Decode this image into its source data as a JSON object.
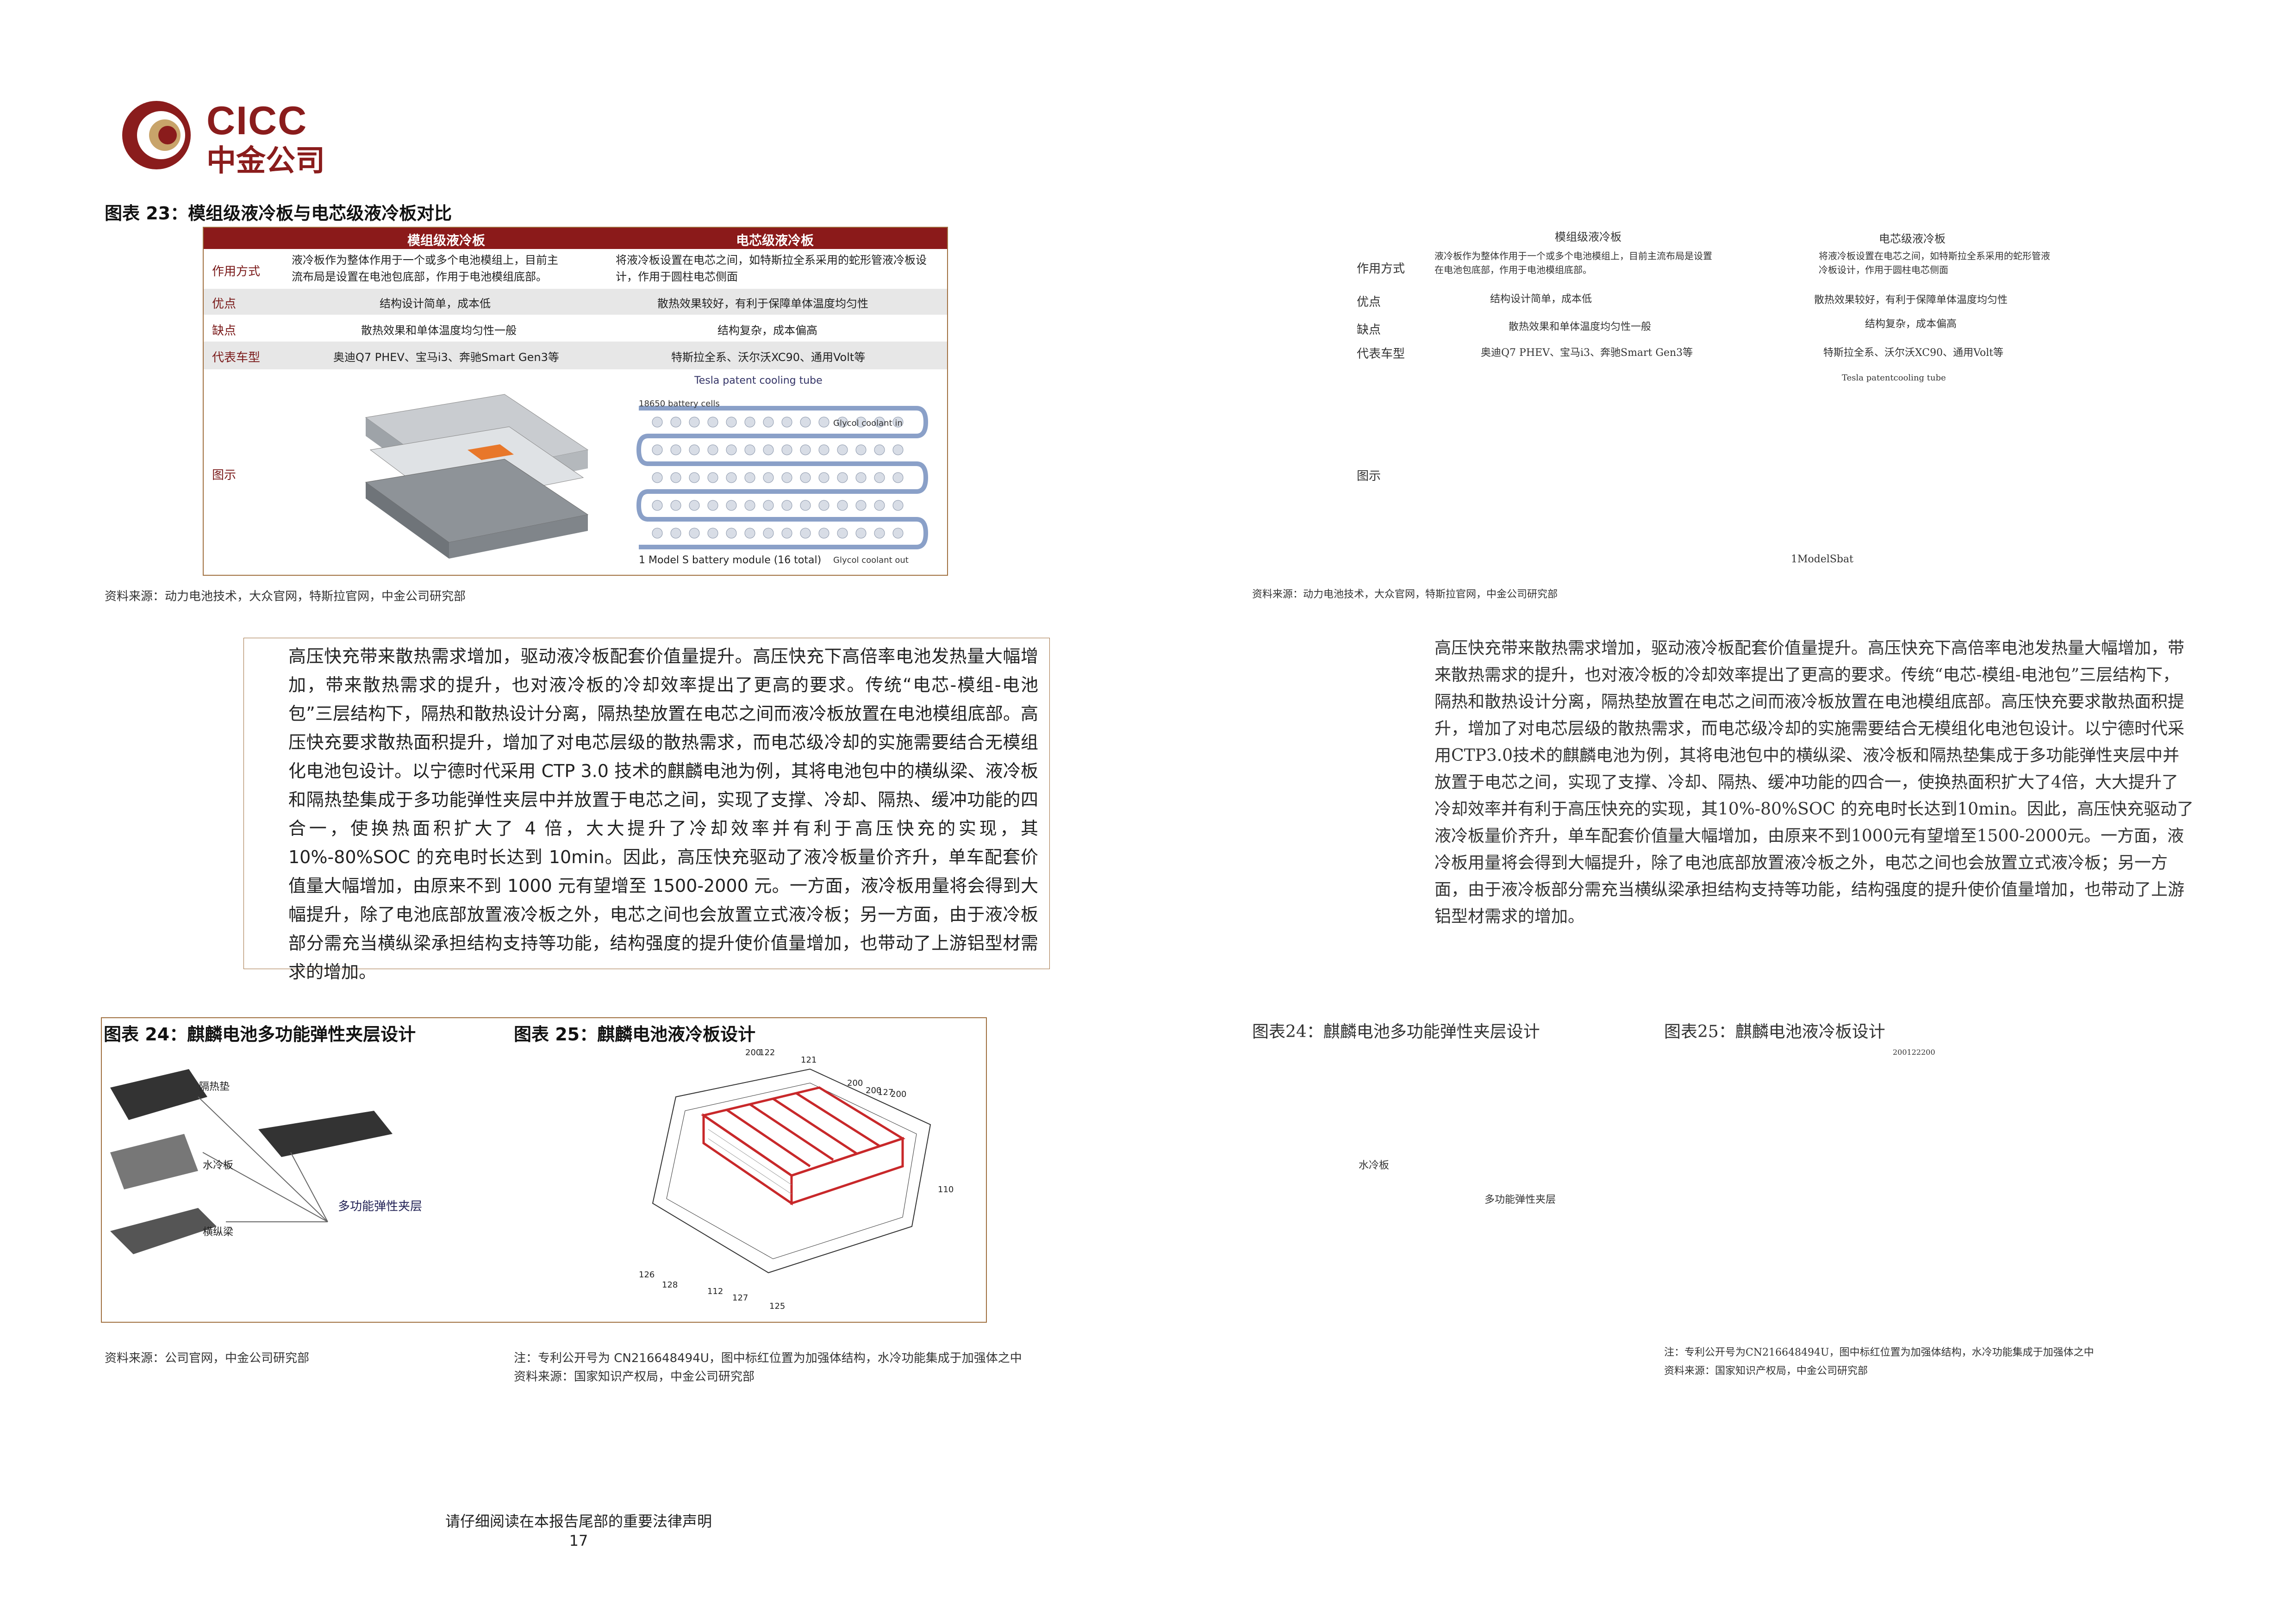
{
  "logo": {
    "brand_en": "CICC",
    "brand_cn": "中金公司"
  },
  "fig23": {
    "title": "图表 23：模组级液冷板与电芯级液冷板对比",
    "col1": "模组级液冷板",
    "col2": "电芯级液冷板",
    "rows": [
      {
        "label": "作用方式",
        "c1": "液冷板作为整体作用于一个或多个电池模组上，目前主流布局是设置在电池包底部，作用于电池模组底部。",
        "c2": "将液冷板设置在电芯之间，如特斯拉全系采用的蛇形管液冷板设计，作用于圆柱电芯侧面"
      },
      {
        "label": "优点",
        "c1": "结构设计简单，成本低",
        "c2": "散热效果较好，有利于保障单体温度均匀性"
      },
      {
        "label": "缺点",
        "c1": "散热效果和单体温度均匀性一般",
        "c2": "结构复杂，成本偏高"
      },
      {
        "label": "代表车型",
        "c1": "奥迪Q7 PHEV、宝马i3、奔驰Smart Gen3等",
        "c2": "特斯拉全系、沃尔沃XC90、通用Volt等"
      }
    ],
    "img_label": "图示",
    "c2_caption": "Tesla patent cooling tube",
    "c2_cells": "18650 battery cells",
    "c2_coolant_in": "Glycol coolant in",
    "c2_coolant_out": "Glycol coolant out",
    "c2_module": "1 Model S battery module (16 total)",
    "source": "资料来源：动力电池技术，大众官网，特斯拉官网，中金公司研究部"
  },
  "para": "高压快充带来散热需求增加，驱动液冷板配套价值量提升。高压快充下高倍率电池发热量大幅增加，带来散热需求的提升，也对液冷板的冷却效率提出了更高的要求。传统“电芯-模组-电池包”三层结构下，隔热和散热设计分离，隔热垫放置在电芯之间而液冷板放置在电池模组底部。高压快充要求散热面积提升，增加了对电芯层级的散热需求，而电芯级冷却的实施需要结合无模组化电池包设计。以宁德时代采用 CTP 3.0 技术的麒麟电池为例，其将电池包中的横纵梁、液冷板和隔热垫集成于多功能弹性夹层中并放置于电芯之间，实现了支撑、冷却、隔热、缓冲功能的四合一，使换热面积扩大了 4 倍，大大提升了冷却效率并有利于高压快充的实现，其 10%-80%SOC 的充电时长达到 10min。因此，高压快充驱动了液冷板量价齐升，单车配套价值量大幅增加，由原来不到 1000 元有望增至 1500-2000 元。一方面，液冷板用量将会得到大幅提升，除了电池底部放置液冷板之外，电芯之间也会放置立式液冷板；另一方面，由于液冷板部分需充当横纵梁承担结构支持等功能，结构强度的提升使价值量增加，也带动了上游铝型材需求的增加。",
  "fig24": {
    "title": "图表 24：麒麟电池多功能弹性夹层设计",
    "lbl_heat": "隔热垫",
    "lbl_water": "水冷板",
    "lbl_beam": "横纵梁",
    "lbl_layer": "多功能弹性夹层",
    "source": "资料来源：公司官网，中金公司研究部"
  },
  "fig25": {
    "title": "图表 25：麒麟电池液冷板设计",
    "nums": [
      "200",
      "122",
      "121",
      "200",
      "200",
      "127",
      "200",
      "110",
      "126",
      "128",
      "112",
      "127",
      "125"
    ],
    "note": "注：专利公开号为 CN216648494U，图中标红位置为加强体结构，水冷功能集成于加强体之中",
    "source": "资料来源：国家知识产权局，中金公司研究部"
  },
  "footer": {
    "notice": "请仔细阅读在本报告尾部的重要法律声明",
    "page": "17"
  },
  "right": {
    "col1": "模组级液冷板",
    "col2": "电芯级液冷板",
    "row_labels": [
      "作用方式",
      "优点",
      "缺点",
      "代表车型"
    ],
    "r1c1": "液冷板作为整体作用于一个或多个电池模组上，目前主流布局是设置在电池包底部，作用于电池模组底部。",
    "r1c2": "将液冷板设置在电芯之间，如特斯拉全系采用的蛇形管液冷板设计，作用于圆柱电芯侧面",
    "r2c1": "结构设计简单，成本低",
    "r2c2": "散热效果较好，有利于保障单体温度均匀性",
    "r3c1": "散热效果和单体温度均匀性一般",
    "r3c2": "结构复杂，成本偏高",
    "r4c1": "奥迪Q7 PHEV、宝马i3、奔驰Smart Gen3等",
    "r4c2": "特斯拉全系、沃尔沃XC90、通用Volt等",
    "tesla": "Tesla patentcooling tube",
    "img": "图示",
    "model": "1ModelSbat",
    "source": "资料来源：动力电池技术，大众官网，特斯拉官网，中金公司研究部",
    "para": "高压快充带来散热需求增加，驱动液冷板配套价值量提升。高压快充下高倍率电池发热量大幅增加，带来散热需求的提升，也对液冷板的冷却效率提出了更高的要求。传统“电芯-模组-电池包”三层结构下，隔热和散热设计分离，隔热垫放置在电芯之间而液冷板放置在电池模组底部。高压快充要求散热面积提升，增加了对电芯层级的散热需求，而电芯级冷却的实施需要结合无模组化电池包设计。以宁德时代采用CTP3.0技术的麒麟电池为例，其将电池包中的横纵梁、液冷板和隔热垫集成于多功能弹性夹层中并放置于电芯之间，实现了支撑、冷却、隔热、缓冲功能的四合一，使换热面积扩大了4倍，大大提升了冷却效率并有利于高压快充的实现，其10%-80%SOC 的充电时长达到10min。因此，高压快充驱动了液冷板量价齐升，单车配套价值量大幅增加，由原来不到1000元有望增至1500-2000元。一方面，液冷板用量将会得到大幅提升，除了电池底部放置液冷板之外，电芯之间也会放置立式液冷板；另一方面，由于液冷板部分需充当横纵梁承担结构支持等功能，结构强度的提升使价值量增加，也带动了上游铝型材需求的增加。",
    "fig24": "图表24：麒麟电池多功能弹性夹层设计",
    "fig25": "图表25：麒麟电池液冷板设计",
    "nums": "200122200",
    "shui": "水冷板",
    "layer": "多功能弹性夹层",
    "note": "注：专利公开号为CN216648494U，图中标红位置为加强体结构，水冷功能集成于加强体之中",
    "source2": "资料来源：国家知识产权局，中金公司研究部"
  }
}
